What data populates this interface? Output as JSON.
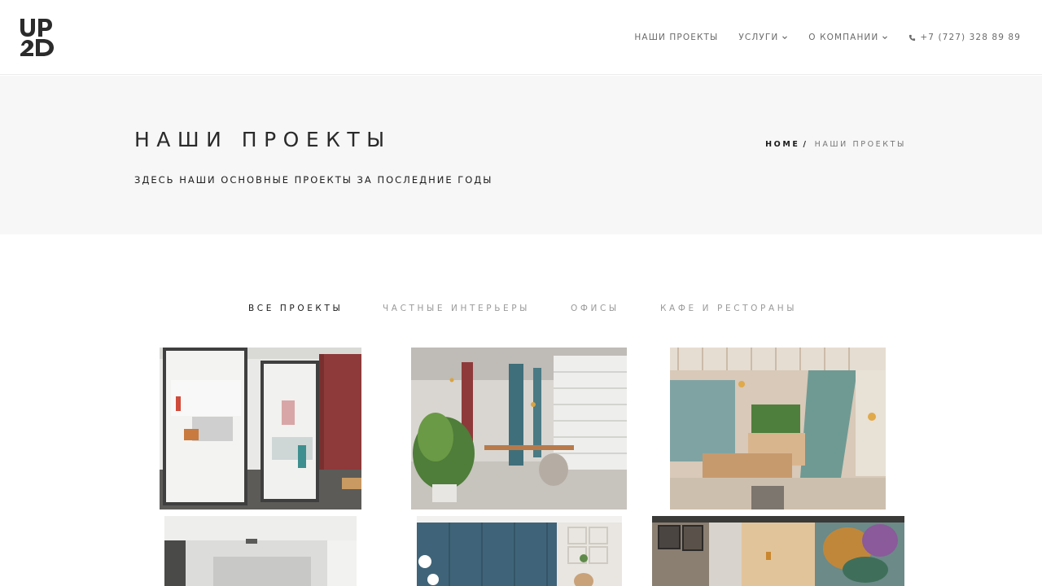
{
  "header": {
    "logo_text": "UP2D",
    "nav": [
      {
        "label": "НАШИ ПРОЕКТЫ"
      },
      {
        "label": "УСЛУГИ",
        "icon": "chevron-down-icon"
      },
      {
        "label": "О КОМПАНИИ",
        "icon": "chevron-down-icon"
      },
      {
        "label": "+7 (727) 328 89 89",
        "icon": "phone-icon"
      }
    ]
  },
  "title_band": {
    "title": "НАШИ ПРОЕКТЫ",
    "subtitle": "ЗДЕСЬ НАШИ ОСНОВНЫЕ ПРОЕКТЫ ЗА ПОСЛЕДНИЕ ГОДЫ",
    "breadcrumb": {
      "home": "HOME",
      "separator": "/",
      "current": "НАШИ ПРОЕКТЫ"
    }
  },
  "filters": [
    {
      "label": "ВСЕ ПРОЕКТЫ",
      "active": true
    },
    {
      "label": "ЧАСТНЫЕ ИНТЕРЬЕРЫ",
      "active": false
    },
    {
      "label": "ОФИСЫ",
      "active": false
    },
    {
      "label": "КАФЕ И РЕСТОРАНЫ",
      "active": false
    }
  ],
  "colors": {
    "background": "#ffffff",
    "band": "#f7f7f7",
    "text_dark": "#222222",
    "text_muted": "#9a9a9a",
    "accent_red": "#8e3a3a",
    "accent_teal": "#3f6f7a"
  }
}
